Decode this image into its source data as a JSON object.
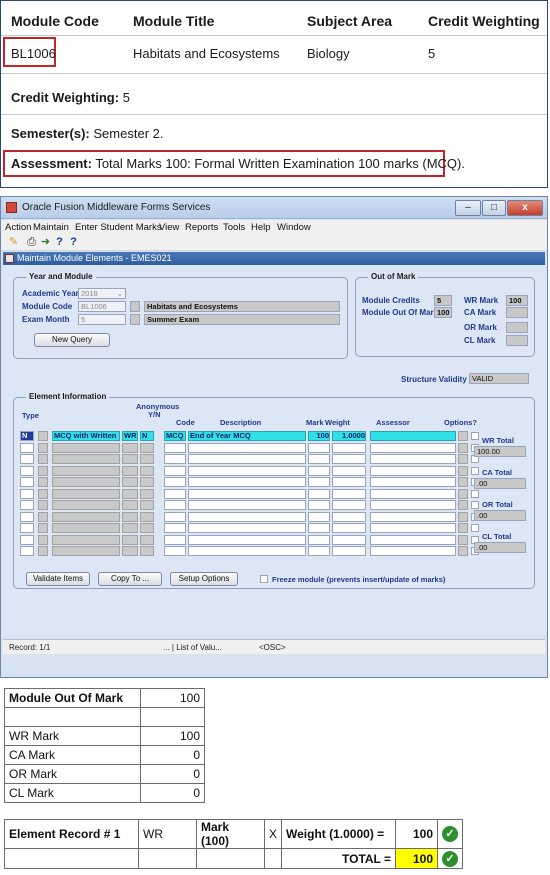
{
  "module_info": {
    "headers": [
      "Module Code",
      "Module Title",
      "Subject Area",
      "Credit Weighting"
    ],
    "row": {
      "code": "BL1006",
      "title": "Habitats and Ecosystems",
      "subject": "Biology",
      "credit": "5"
    },
    "credit_label": "Credit Weighting:",
    "credit_value": "5",
    "semester_label": "Semester(s):",
    "semester_value": "Semester 2.",
    "assessment_label": "Assessment:",
    "assessment_value": "Total Marks 100: Formal Written Examination 100 marks (MCQ).",
    "highlight_color": "#c0262b"
  },
  "oracle": {
    "window_title": "Oracle Fusion Middleware Forms Services",
    "menu": [
      "Action",
      "Maintain",
      "Enter Student Marks",
      "View",
      "Reports",
      "Tools",
      "Help",
      "Window"
    ],
    "toolbar_icons": [
      "open-folder-icon",
      "print-icon",
      "navigate-icon",
      "help-icon",
      "help-icon"
    ],
    "toolbar_glyphs": [
      "✎",
      "⎙",
      "➜",
      "?",
      "?"
    ],
    "form_title": "Maintain Module Elements - EMES021",
    "year_module": {
      "group_title": "Year and Module",
      "academic_year_label": "Academic Year",
      "academic_year_value": "2018",
      "module_code_label": "Module Code",
      "module_code_value": "BL1006",
      "module_title_value": "Habitats and Ecosystems",
      "exam_month_label": "Exam Month",
      "exam_month_value": "5",
      "exam_month_name": "Summer Exam",
      "new_query_label": "New Query"
    },
    "out_of_mark": {
      "group_title": "Out of Mark",
      "module_credits_label": "Module Credits",
      "module_credits_value": "5",
      "module_out_of_label": "Module Out Of Mark",
      "module_out_of_value": "100",
      "wr_label": "WR Mark",
      "wr_value": "100",
      "ca_label": "CA Mark",
      "ca_value": "",
      "or_label": "OR Mark",
      "or_value": "",
      "cl_label": "CL Mark",
      "cl_value": ""
    },
    "structure_validity_label": "Structure Validity",
    "structure_validity_value": "VALID",
    "element_info": {
      "group_title": "Element Information",
      "headers": {
        "type": "Type",
        "anonymous": "Anonymous",
        "yn": "Y/N",
        "code": "Code",
        "description": "Description",
        "mark": "Mark",
        "weight": "Weight",
        "assessor": "Assessor",
        "options": "Options?"
      },
      "row1": {
        "type": "N",
        "name": "MCQ with Written",
        "wr": "WR",
        "anon": "N",
        "code": "MCQ",
        "description": "End of Year MCQ",
        "mark": "100",
        "weight": "1.0000"
      },
      "wr_total_label": "WR Total",
      "wr_total_value": "100.00",
      "ca_total_label": "CA Total",
      "ca_total_value": ".00",
      "or_total_label": "OR Total",
      "or_total_value": ".00",
      "cl_total_label": "CL Total",
      "cl_total_value": ".00"
    },
    "buttons": {
      "validate": "Validate Items",
      "copy": "Copy To ...",
      "setup": "Setup Options"
    },
    "freeze_label": "Freeze module (prevents insert/update of marks)",
    "status": {
      "record": "Record: 1/1",
      "list": "... | List of Valu...",
      "osc": "<OSC>"
    }
  },
  "mark_table": {
    "rows": [
      {
        "label": "Module Out Of Mark",
        "value": "100",
        "bold": true
      },
      {
        "label": "",
        "value": ""
      },
      {
        "label": "WR Mark",
        "value": "100"
      },
      {
        "label": "CA Mark",
        "value": "0"
      },
      {
        "label": "OR Mark",
        "value": "0"
      },
      {
        "label": "CL Mark",
        "value": "0"
      }
    ]
  },
  "total_table": {
    "record_label": "Element Record # 1",
    "type": "WR",
    "mark": "Mark (100)",
    "times": "X",
    "weight": "Weight (1.0000) =",
    "value": "100",
    "total_label": "TOTAL =",
    "total_value": "100",
    "total_fill": "#ffff00",
    "tick_color": "#2f8f2f"
  }
}
